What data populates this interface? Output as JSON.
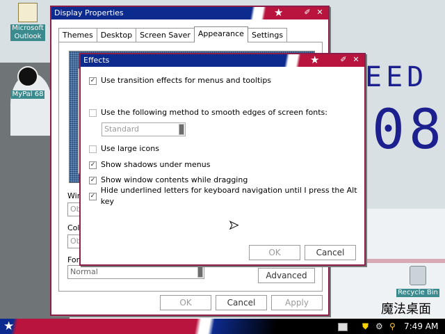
{
  "desktop": {
    "icons": {
      "outlook": {
        "label_line1": "Microsoft",
        "label_line2": "Outlook"
      },
      "mypal": {
        "label": "MyPal 68"
      },
      "recycle": {
        "label": "Recycle Bin"
      }
    },
    "wallpaper_text": {
      "eed": "EED",
      "year": "08",
      "logo": "魔法桌面"
    }
  },
  "display_properties": {
    "title": "Display Properties",
    "tabs": [
      {
        "label": "Themes"
      },
      {
        "label": "Desktop"
      },
      {
        "label": "Screen Saver"
      },
      {
        "label": "Appearance"
      },
      {
        "label": "Settings"
      }
    ],
    "labels": {
      "windows_partial": "Wind",
      "color_partial": "Colo",
      "font_partial": "Font"
    },
    "combos": {
      "windows_value_partial": "Oba",
      "color_value_partial": "Oba",
      "font_smoothing": "Normal"
    },
    "advanced_label": "Advanced",
    "ok_label": "OK",
    "cancel_label": "Cancel",
    "apply_label": "Apply"
  },
  "effects": {
    "title": "Effects",
    "options": [
      {
        "label": "Use transition effects for menus and tooltips",
        "checked": true
      },
      {
        "label": "Use the following method to smooth edges of screen fonts:",
        "checked": false
      },
      {
        "label": "Use large icons",
        "checked": false
      },
      {
        "label": "Show shadows under menus",
        "checked": true
      },
      {
        "label": "Show window contents while dragging",
        "checked": true
      },
      {
        "label": "Hide underlined letters for keyboard navigation until I press the Alt key",
        "checked": true
      }
    ],
    "smoothing_method": "Standard",
    "ok_label": "OK",
    "cancel_label": "Cancel"
  },
  "taskbar": {
    "clock": "7:49 AM",
    "icons": [
      "start-star-icon",
      "keyboard-icon",
      "shield-icon",
      "network-icon",
      "search-icon"
    ]
  },
  "colors": {
    "title_blue": "#0d2b8f",
    "title_red": "#b8143e",
    "window_border": "#8c1f4a"
  }
}
